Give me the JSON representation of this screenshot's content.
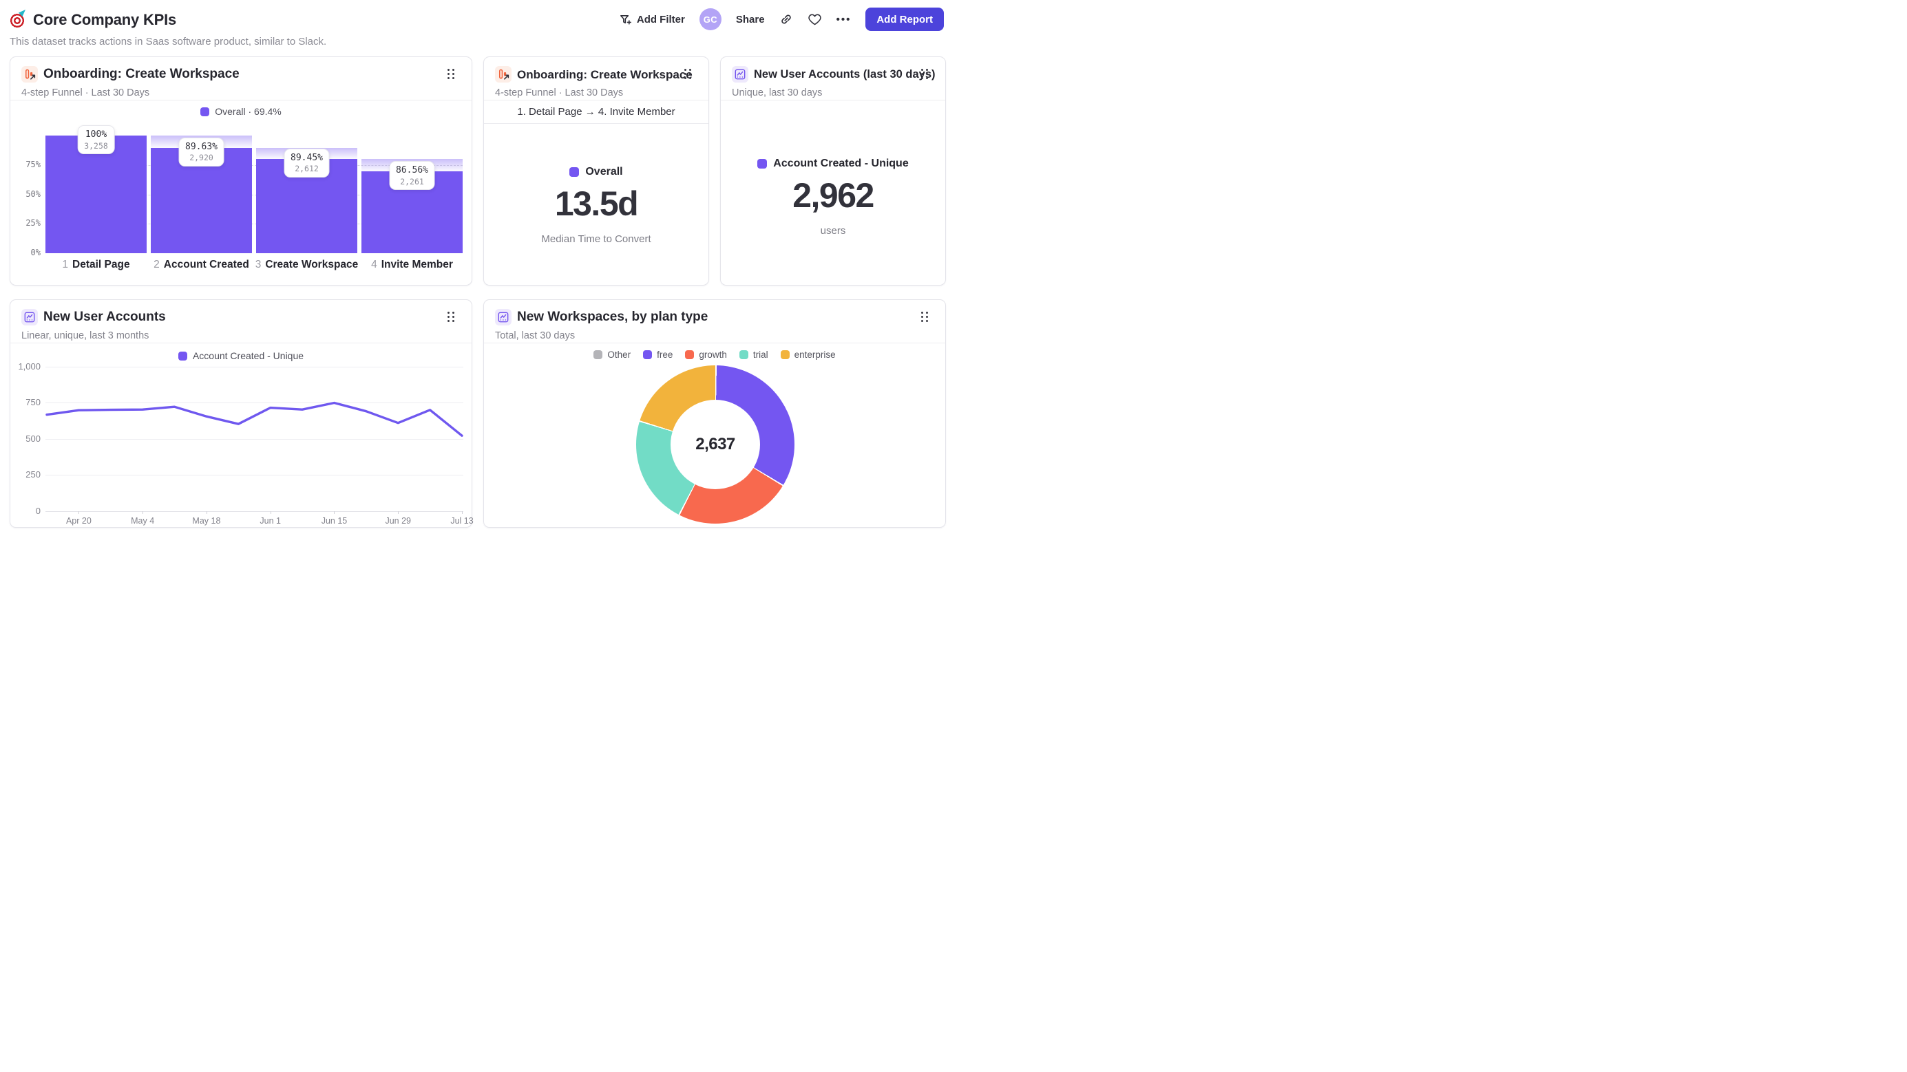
{
  "page": {
    "title": "Core Company KPIs",
    "subtitle": "This dataset tracks actions in Saas software product, similar to Slack.",
    "title_icon": "dart-target"
  },
  "toolbar": {
    "add_filter_label": "Add Filter",
    "avatar_initials": "GC",
    "share_label": "Share",
    "more_label": "•••",
    "add_report_label": "Add Report",
    "accent_color": "#4C43DB"
  },
  "cards": {
    "funnel": {
      "title": "Onboarding: Create Workspace",
      "subtitle": "4-step Funnel · Last 30 Days",
      "legend_label": "Overall · 69.4%"
    },
    "funnel_metric": {
      "title": "Onboarding: Create Workspace",
      "subtitle": "4-step Funnel · Last 30 Days",
      "range_label": "1. Detail Page → 4. Invite Member",
      "legend_label": "Overall",
      "value": "13.5d",
      "caption": "Median Time to Convert"
    },
    "accounts_metric": {
      "title": "New User Accounts (last 30 days)",
      "subtitle": "Unique, last 30 days",
      "legend_label": "Account Created - Unique",
      "value": "2,962",
      "caption": "users"
    },
    "accounts_line": {
      "title": "New User Accounts",
      "subtitle": "Linear, unique, last 3 months",
      "legend_label": "Account Created - Unique"
    },
    "workspaces_donut": {
      "title": "New Workspaces, by plan type",
      "subtitle": "Total, last 30 days",
      "center_value": "2,637"
    }
  },
  "chart_data": [
    {
      "type": "funnel_bar",
      "title": "Onboarding: Create Workspace",
      "overall_conversion": "69.4%",
      "bar_color": "#7456F1",
      "yticks": [
        "0%",
        "25%",
        "50%",
        "75%"
      ],
      "ylim": [
        0,
        100
      ],
      "grid": "dashed",
      "steps": [
        {
          "num": "1",
          "label": "Detail Page",
          "conversion_label": "100%",
          "count_label": "3,258",
          "count": 3258
        },
        {
          "num": "2",
          "label": "Account Created",
          "conversion_label": "89.63%",
          "count_label": "2,920",
          "count": 2920
        },
        {
          "num": "3",
          "label": "Create Workspace",
          "conversion_label": "89.45%",
          "count_label": "2,612",
          "count": 2612
        },
        {
          "num": "4",
          "label": "Invite Member",
          "conversion_label": "86.56%",
          "count_label": "2,261",
          "count": 2261
        }
      ]
    },
    {
      "type": "line",
      "title": "New User Accounts",
      "series": [
        {
          "name": "Account Created - Unique",
          "values": [
            668,
            699,
            702,
            704,
            723,
            656,
            604,
            716,
            704,
            750,
            692,
            611,
            701,
            523
          ]
        }
      ],
      "x_tick_labels": [
        "Apr 20",
        "May 4",
        "May 18",
        "Jun 1",
        "Jun 15",
        "Jun 29",
        "Jul 13"
      ],
      "x_tick_indices": [
        1,
        3,
        5,
        7,
        9,
        11,
        13
      ],
      "yticks": [
        "0",
        "250",
        "500",
        "750",
        "1,000"
      ],
      "ylim": [
        0,
        1000
      ],
      "line_color": "#6F58EF",
      "grid": true,
      "legend_position": "top"
    },
    {
      "type": "donut",
      "title": "New Workspaces, by plan type",
      "total_label": "2,637",
      "total": 2637,
      "legend_position": "top",
      "slices": [
        {
          "label": "Other",
          "value": 0,
          "color": "#B4B4B8"
        },
        {
          "label": "free",
          "value": 884,
          "color": "#7456F1"
        },
        {
          "label": "growth",
          "value": 630,
          "color": "#F8694E"
        },
        {
          "label": "trial",
          "value": 586,
          "color": "#72DCC6"
        },
        {
          "label": "enterprise",
          "value": 537,
          "color": "#F2B33C"
        }
      ]
    }
  ]
}
